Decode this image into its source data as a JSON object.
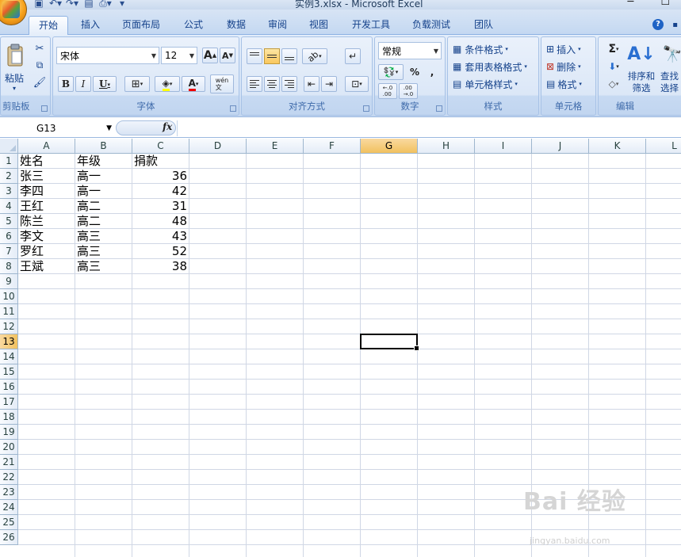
{
  "window": {
    "title": "实例3.xlsx - Microsoft Excel"
  },
  "ribbon_tabs": [
    "开始",
    "插入",
    "页面布局",
    "公式",
    "数据",
    "审阅",
    "视图",
    "开发工具",
    "负载测试",
    "团队"
  ],
  "groups": {
    "clipboard": {
      "label": "剪贴板",
      "paste": "粘贴"
    },
    "font": {
      "label": "字体",
      "font_name": "宋体",
      "font_size": "12",
      "bold": "B",
      "italic": "I",
      "underline": "U",
      "grow": "A",
      "shrink": "A",
      "phonetic": "wén\n文"
    },
    "alignment": {
      "label": "对齐方式"
    },
    "number": {
      "label": "数字",
      "format": "常规",
      "percent": "%",
      "comma": ",",
      "inc_decimal": "←.0\n.00",
      "dec_decimal": ".00\n→.0"
    },
    "styles": {
      "label": "样式",
      "conditional": "条件格式",
      "table": "套用表格格式",
      "cell": "单元格样式"
    },
    "cells": {
      "label": "单元格",
      "insert": "插入",
      "delete": "删除",
      "format": "格式"
    },
    "editing": {
      "label": "编辑",
      "sum": "Σ",
      "sort": "排序和\n筛选",
      "find": "查找\n选择"
    }
  },
  "formula_bar": {
    "name_box": "G13",
    "fx": "fx",
    "formula": ""
  },
  "columns": [
    "A",
    "B",
    "C",
    "D",
    "E",
    "F",
    "G",
    "H",
    "I",
    "J",
    "K",
    "L"
  ],
  "rows": [
    "1",
    "2",
    "3",
    "4",
    "5",
    "6",
    "7",
    "8",
    "9",
    "10",
    "11",
    "12",
    "13",
    "14",
    "15",
    "16",
    "17",
    "18",
    "19",
    "20",
    "21",
    "22",
    "23",
    "24",
    "25",
    "26"
  ],
  "selected": {
    "col": "G",
    "row": "13"
  },
  "table": {
    "header": [
      "姓名",
      "年级",
      "捐款"
    ],
    "rows": [
      [
        "张三",
        "高一",
        "36"
      ],
      [
        "李四",
        "高一",
        "42"
      ],
      [
        "王红",
        "高二",
        "31"
      ],
      [
        "陈兰",
        "高二",
        "48"
      ],
      [
        "李文",
        "高三",
        "43"
      ],
      [
        "罗红",
        "高三",
        "52"
      ],
      [
        "王斌",
        "高三",
        "38"
      ]
    ]
  },
  "watermark": {
    "text": "Bai 经验",
    "sub": "jingyan.baidu.com"
  },
  "colors": {
    "accent": "#15428b",
    "selected_header": "#f1c15f",
    "grid": "#d0d7e5"
  }
}
